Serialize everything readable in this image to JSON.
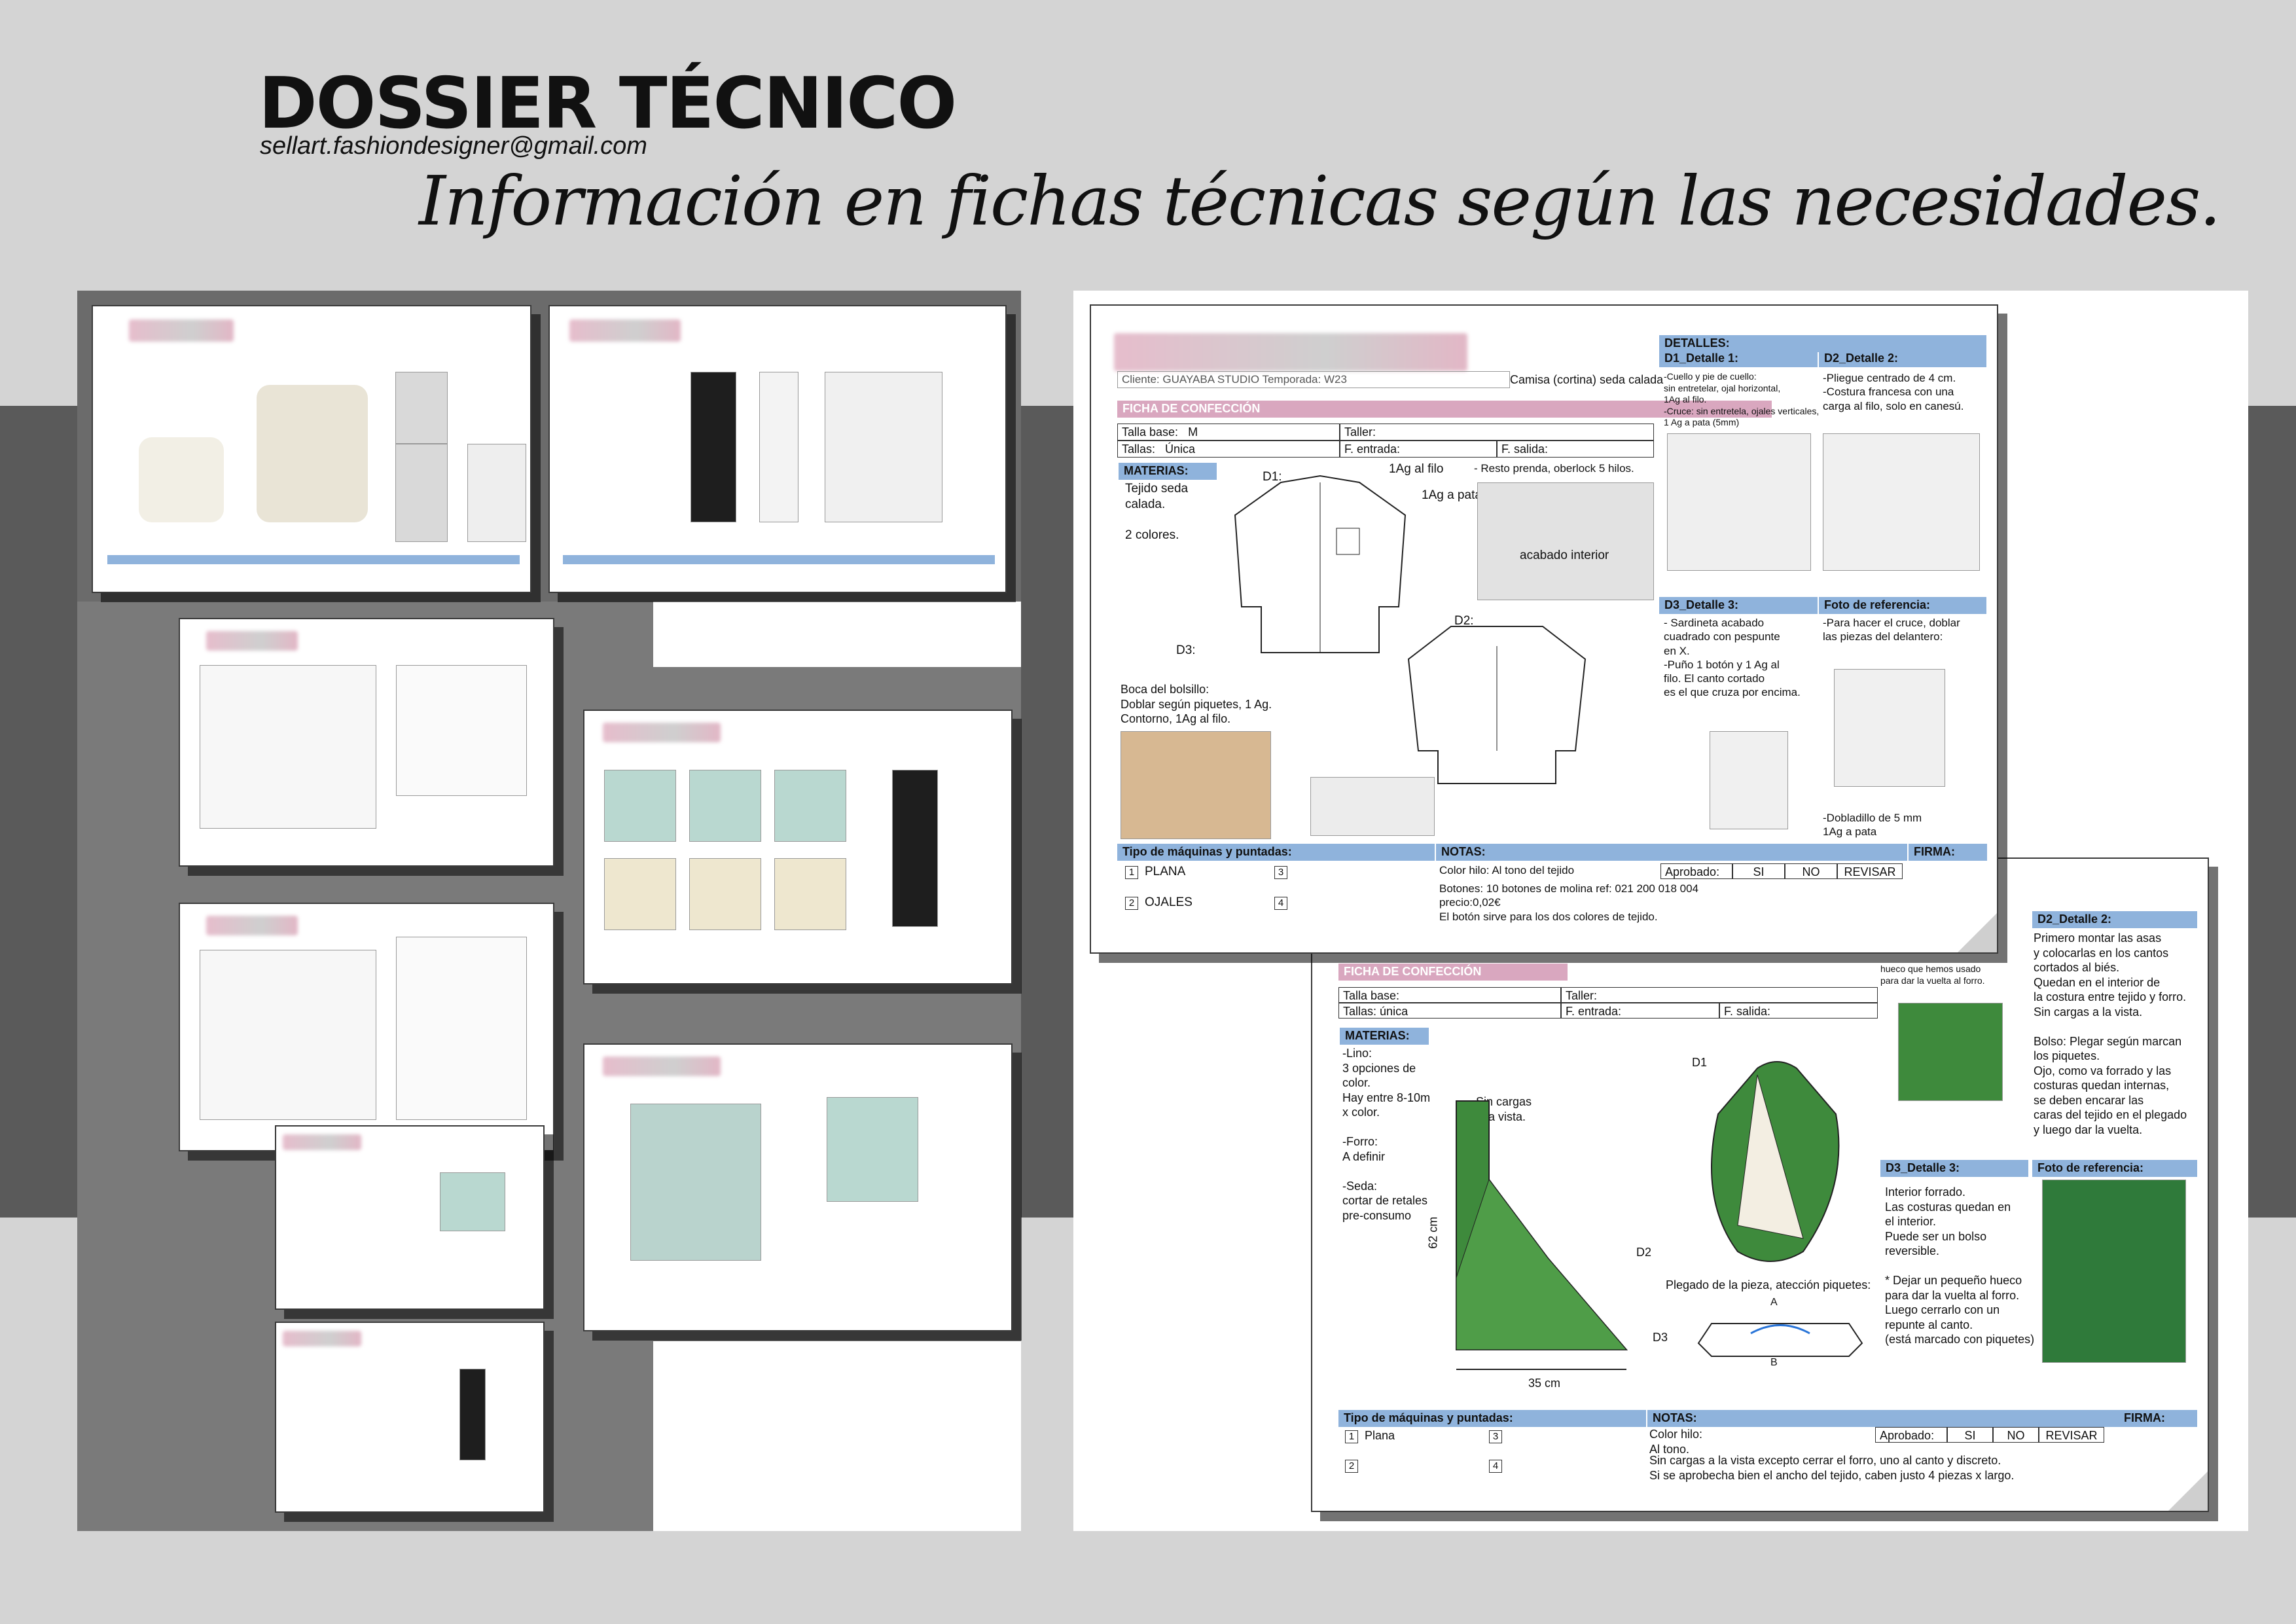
{
  "header": {
    "title": "DOSSIER TÉCNICO",
    "email": "sellart.fashiondesigner@gmail.com",
    "tagline": "Información en fichas técnicas según las necesidades."
  },
  "colors": {
    "blue_header": "#8fb3dc",
    "pink_header": "#d9a7bf",
    "band": "#5a5a5a",
    "bag_green": "#3e8a3c"
  },
  "shirt_sheet": {
    "client_line": "Cliente: GUAYABA STUDIO   Temporada: W23",
    "garment": "Camisa (cortina) seda calada",
    "section": "FICHA DE CONFECCIÓN",
    "talla_base_label": "Talla base:",
    "talla_base": "M",
    "taller_label": "Taller:",
    "tallas_label": "Tallas:",
    "tallas": "Única",
    "entrada_label": "F. entrada:",
    "salida_label": "F. salida:",
    "materias_label": "MATERIAS:",
    "materias": "Tejido seda\ncalada.\n\n2 colores.",
    "d1": "D1:",
    "d2": "D2:",
    "d3": "D3:",
    "ag_filo": "1Ag al filo",
    "ag_pata": "1Ag a pata",
    "resto": "- Resto prenda, oberlock 5 hilos.",
    "acabado": "acabado interior",
    "bolsillo": "Boca del bolsillo:\nDoblar según piquetes, 1 Ag.\nContorno, 1Ag al filo.",
    "detalles_label": "DETALLES:",
    "d1_title": "D1_Detalle 1:",
    "d1_text": "-Cuello y pie de cuello:\nsin entretelar, ojal horizontal,\n1Ag al filo.\n-Cruce: sin entretela, ojales verticales,\n1 Ag a pata (5mm)",
    "d2_title": "D2_Detalle 2:",
    "d2_text": "-Pliegue centrado de 4 cm.\n-Costura francesa con una\ncarga al filo, solo en canesú.",
    "d3_title": "D3_Detalle 3:",
    "d3_text": "- Sardineta acabado\ncuadrado con pespunte\nen X.\n-Puño 1 botón y 1 Ag al\nfilo. El canto cortado\nes el que cruza por encima.",
    "foto_title": "Foto de referencia:",
    "foto_text": "-Para hacer el cruce, doblar\nlas piezas del delantero:",
    "dobladillo": "-Dobladillo de 5 mm\n1Ag a pata",
    "maquinas_label": "Tipo de máquinas y puntadas:",
    "maq1": "PLANA",
    "maq2": "OJALES",
    "n1": "1",
    "n2": "2",
    "n3": "3",
    "n4": "4",
    "notas_label": "NOTAS:",
    "color_hilo": "Color hilo: Al tono del tejido",
    "botones": "Botones: 10 botones de molina ref: 021 200 018 004\nprecio:0,02€\nEl botón sirve para los dos colores de tejido.",
    "aprobado": "Aprobado:",
    "si": "SI",
    "no": "NO",
    "revisar": "REVISAR",
    "firma": "FIRMA:"
  },
  "bag_sheet": {
    "section": "FICHA DE CONFECCIÓN",
    "talla_base_label": "Talla base:",
    "taller_label": "Taller:",
    "tallas_label": "Tallas:",
    "tallas": "única",
    "entrada_label": "F. entrada:",
    "salida_label": "F. salida:",
    "materias_label": "MATERIAS:",
    "materias": "-Lino:\n3 opciones de\ncolor.\nHay entre 8-10m\nx color.\n\n-Forro:\nA definir\n\n-Seda:\ncortar de retales\npre-consumo",
    "sin_cargas": "Sin cargas\na la vista.",
    "dim_h": "62 cm",
    "dim_w": "35 cm",
    "d1": "D1",
    "d2": "D2",
    "d3": "D3",
    "plegado": "Plegado de la pieza, atección piquetes:",
    "a": "A",
    "b": "B",
    "top_text": "hueco que hemos usado\npara dar la vuelta al forro.",
    "d2_title": "D2_Detalle 2:",
    "d2_text": "Primero montar las asas\ny colocarlas en los cantos\ncortados al biés.\nQuedan en el interior de\nla costura entre tejido y forro.\nSin cargas a la vista.\n\nBolso: Plegar según marcan\nlos piquetes.\nOjo, como va forrado y las\ncosturas quedan internas,\nse deben encarar las\ncaras del tejido en el plegado\ny luego dar la vuelta.",
    "d3_title": "D3_Detalle 3:",
    "d3_text": "Interior forrado.\nLas costuras quedan en\nel interior.\nPuede ser un bolso\nreversible.\n\n* Dejar un pequeño hueco\npara dar la vuelta al forro.\nLuego cerrarlo con un\nrepunte al canto.\n(está marcado con piquetes)",
    "foto_title": "Foto de referencia:",
    "maquinas_label": "Tipo de máquinas y puntadas:",
    "maq1": "Plana",
    "n1": "1",
    "n2": "2",
    "n3": "3",
    "n4": "4",
    "notas_label": "NOTAS:",
    "color_hilo": "Color hilo:\nAl tono.",
    "notas_text": "Sin cargas a la vista excepto cerrar el forro, uno al canto y discreto.\nSi se aprobecha bien el ancho del tejido, caben justo 4 piezas x largo.",
    "aprobado": "Aprobado:",
    "si": "SI",
    "no": "NO",
    "revisar": "REVISAR",
    "firma": "FIRMA:"
  }
}
